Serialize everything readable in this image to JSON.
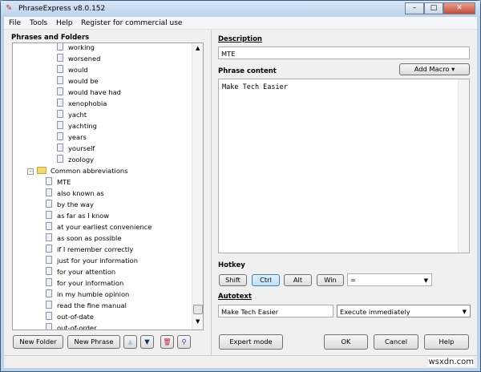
{
  "window": {
    "title": "PhraseExpress v8.0.152"
  },
  "menu": [
    "File",
    "Tools",
    "Help",
    "Register for commercial use"
  ],
  "left": {
    "heading": "Phrases and Folders",
    "items_top": [
      "working",
      "worsened",
      "would",
      "would be",
      "would have had",
      "xenophobia",
      "yacht",
      "yachting",
      "years",
      "yourself",
      "zoology"
    ],
    "folder": "Common abbreviations",
    "items_abbr": [
      "MTE",
      "also known as",
      "by the way",
      "as far as I know",
      "at your earliest convenience",
      "as soon as possible",
      "if I remember correctly",
      "just for your information",
      "for your attention",
      "for your information",
      "in my humble opinion",
      "read the fine manual",
      "out-of-date",
      "out-of-order"
    ],
    "new_folder": "New Folder",
    "new_phrase": "New Phrase"
  },
  "right": {
    "description_label": "Description",
    "description_value": "MTE",
    "phrase_label": "Phrase content",
    "add_macro": "Add Macro",
    "phrase_content": "Make Tech Easier",
    "hotkey_label": "Hotkey",
    "hotkeys": [
      "Shift",
      "Ctrl",
      "Alt",
      "Win"
    ],
    "hotkey_key": "=",
    "autotext_label": "Autotext",
    "autotext_value": "Make Tech Easier",
    "autotext_mode": "Execute immediately",
    "expert_mode": "Expert mode",
    "ok": "OK",
    "cancel": "Cancel",
    "help": "Help"
  },
  "watermark": "wsxdn.com"
}
